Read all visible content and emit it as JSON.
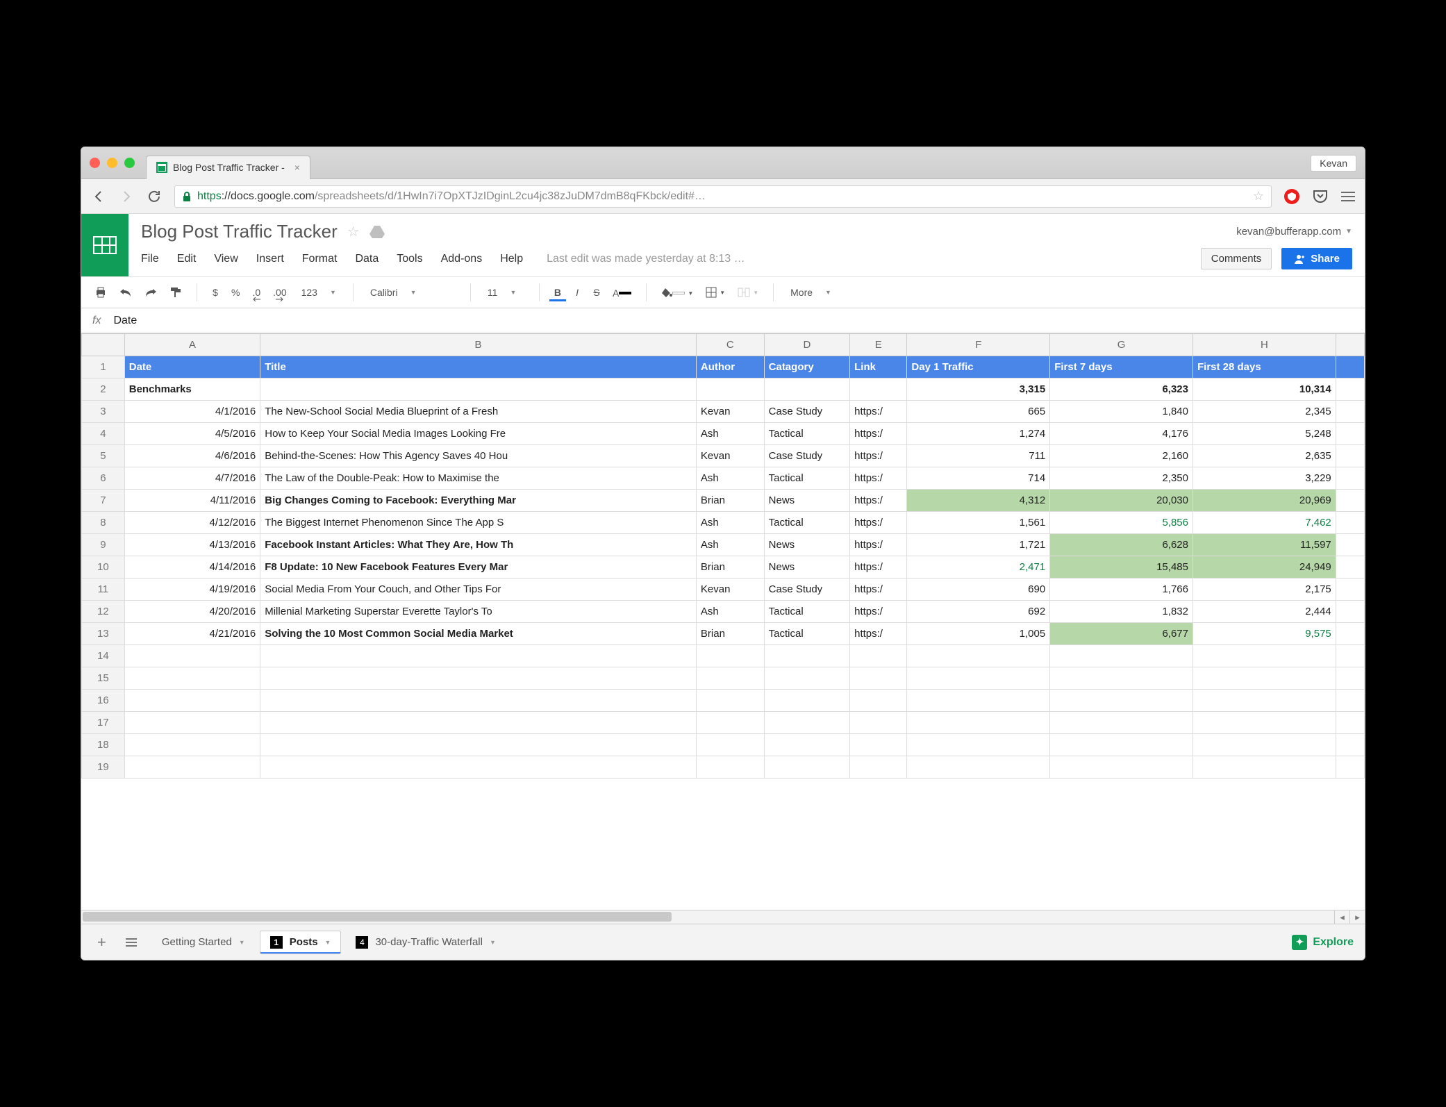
{
  "browser": {
    "tab_title": "Blog Post Traffic Tracker - ",
    "user_button": "Kevan",
    "url_scheme": "https",
    "url_host": "://docs.google.com",
    "url_path": "/spreadsheets/d/1HwIn7i7OpXTJzIDginL2cu4jc38zJuDM7dmB8qFKbck/edit#…"
  },
  "docs": {
    "title": "Blog Post Traffic Tracker",
    "account": "kevan@bufferapp.com",
    "menus": [
      "File",
      "Edit",
      "View",
      "Insert",
      "Format",
      "Data",
      "Tools",
      "Add-ons",
      "Help"
    ],
    "status": "Last edit was made yesterday at 8:13 …",
    "comments_label": "Comments",
    "share_label": "Share"
  },
  "toolbar": {
    "currency": "$",
    "percent": "%",
    "dec_dec": ".0",
    "dec_inc": ".00",
    "num_fmt": "123",
    "font": "Calibri",
    "size": "11",
    "bold": "B",
    "italic": "I",
    "strike": "S",
    "textA": "A",
    "more": "More"
  },
  "formula": {
    "label": "fx",
    "value": "Date"
  },
  "columns": {
    "letters": [
      "",
      "A",
      "B",
      "C",
      "D",
      "E",
      "F",
      "G",
      "H",
      ""
    ],
    "widths": [
      60,
      190,
      610,
      95,
      120,
      80,
      200,
      200,
      200,
      40
    ],
    "headers": [
      "Date",
      "Title",
      "Author",
      "Catagory",
      "Link",
      "Day 1 Traffic",
      "First 7 days",
      "First 28 days"
    ]
  },
  "benchmarks": {
    "label": "Benchmarks",
    "day1": "3,315",
    "d7": "6,323",
    "d28": "10,314"
  },
  "rows": [
    {
      "n": 3,
      "date": "4/1/2016",
      "title": "The New-School Social Media Blueprint of a Fresh ",
      "author": "Kevan",
      "cat": "Case Study",
      "link": "https:/",
      "d1": "665",
      "d7": "1,840",
      "d28": "2,345"
    },
    {
      "n": 4,
      "date": "4/5/2016",
      "title": "How to Keep Your Social Media Images Looking Fre",
      "author": "Ash",
      "cat": "Tactical",
      "link": "https:/",
      "d1": "1,274",
      "d7": "4,176",
      "d28": "5,248"
    },
    {
      "n": 5,
      "date": "4/6/2016",
      "title": "Behind-the-Scenes: How This Agency Saves 40 Hou",
      "author": "Kevan",
      "cat": "Case Study",
      "link": "https:/",
      "d1": "711",
      "d7": "2,160",
      "d28": "2,635"
    },
    {
      "n": 6,
      "date": "4/7/2016",
      "title": "The Law of the Double-Peak: How to Maximise the ",
      "author": "Ash",
      "cat": "Tactical",
      "link": "https:/",
      "d1": "714",
      "d7": "2,350",
      "d28": "3,229"
    },
    {
      "n": 7,
      "date": "4/11/2016",
      "title": "Big Changes Coming to Facebook: Everything Mar",
      "author": "Brian",
      "cat": "News",
      "link": "https:/",
      "d1": "4,312",
      "d1_bg": true,
      "d7": "20,030",
      "d7_bg": true,
      "d28": "20,969",
      "d28_bg": true,
      "bold": true
    },
    {
      "n": 8,
      "date": "4/12/2016",
      "title": "The Biggest Internet Phenomenon Since The App S",
      "author": "Ash",
      "cat": "Tactical",
      "link": "https:/",
      "d1": "1,561",
      "d7": "5,856",
      "d7_txt": true,
      "d28": "7,462",
      "d28_txt": true
    },
    {
      "n": 9,
      "date": "4/13/2016",
      "title": "Facebook Instant Articles: What They Are, How Th",
      "author": "Ash",
      "cat": "News",
      "link": "https:/",
      "d1": "1,721",
      "d7": "6,628",
      "d7_bg": true,
      "d28": "11,597",
      "d28_bg": true,
      "bold": true
    },
    {
      "n": 10,
      "date": "4/14/2016",
      "title": "F8 Update: 10 New Facebook Features Every Mar",
      "author": "Brian",
      "cat": "News",
      "link": "https:/",
      "d1": "2,471",
      "d1_txt": true,
      "d7": "15,485",
      "d7_bg": true,
      "d28": "24,949",
      "d28_bg": true,
      "bold": true
    },
    {
      "n": 11,
      "date": "4/19/2016",
      "title": "Social Media From Your Couch, and Other Tips For",
      "author": "Kevan",
      "cat": "Case Study",
      "link": "https:/",
      "d1": "690",
      "d7": "1,766",
      "d28": "2,175"
    },
    {
      "n": 12,
      "date": "4/20/2016",
      "title": "Millenial Marketing Superstar Everette Taylor's To",
      "author": "Ash",
      "cat": "Tactical",
      "link": "https:/",
      "d1": "692",
      "d7": "1,832",
      "d28": "2,444"
    },
    {
      "n": 13,
      "date": "4/21/2016",
      "title": "Solving the 10 Most Common Social Media Market",
      "author": "Brian",
      "cat": "Tactical",
      "link": "https:/",
      "d1": "1,005",
      "d7": "6,677",
      "d7_bg": true,
      "d28": "9,575",
      "d28_txt": true,
      "bold": true
    }
  ],
  "empty_rows": [
    14,
    15,
    16,
    17,
    18,
    19
  ],
  "sheet_tabs": [
    {
      "label": "Getting Started",
      "badge": null,
      "active": false
    },
    {
      "label": "Posts",
      "badge": "1",
      "active": true
    },
    {
      "label": "30-day-Traffic Waterfall",
      "badge": "4",
      "active": false
    }
  ],
  "explore_label": "Explore"
}
